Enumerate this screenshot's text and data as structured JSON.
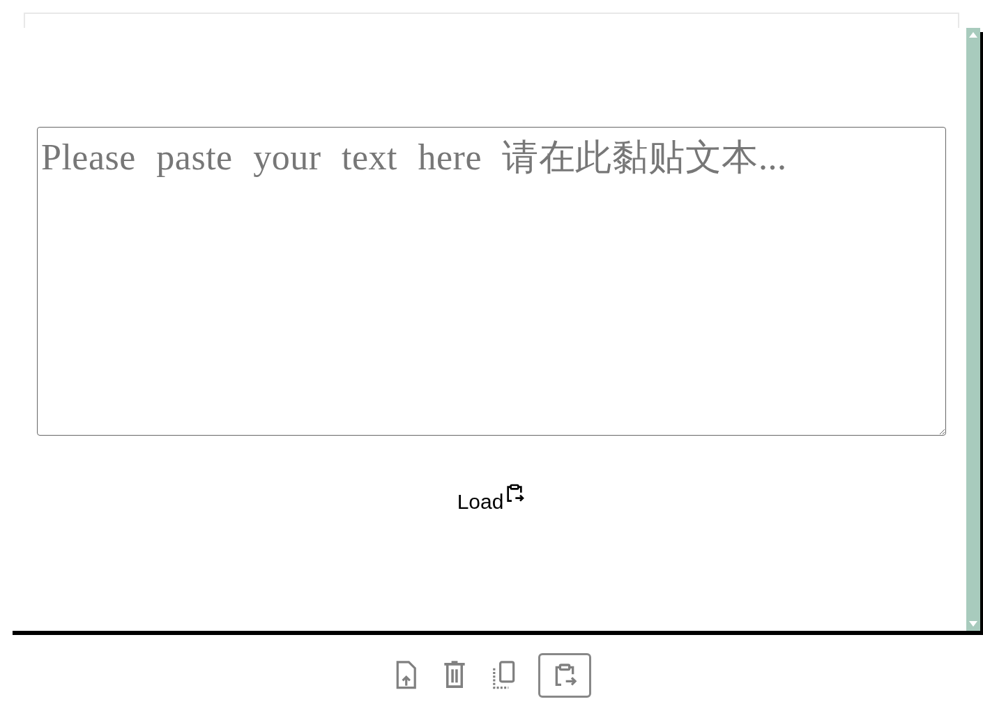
{
  "editor": {
    "placeholder": "Please paste your text here 请在此黏贴文本..."
  },
  "load_button": {
    "label": "Load"
  },
  "toolbar": [
    {
      "kind": "upload",
      "selected": false
    },
    {
      "kind": "delete",
      "selected": false
    },
    {
      "kind": "copy",
      "selected": false
    },
    {
      "kind": "paste",
      "selected": true
    }
  ]
}
